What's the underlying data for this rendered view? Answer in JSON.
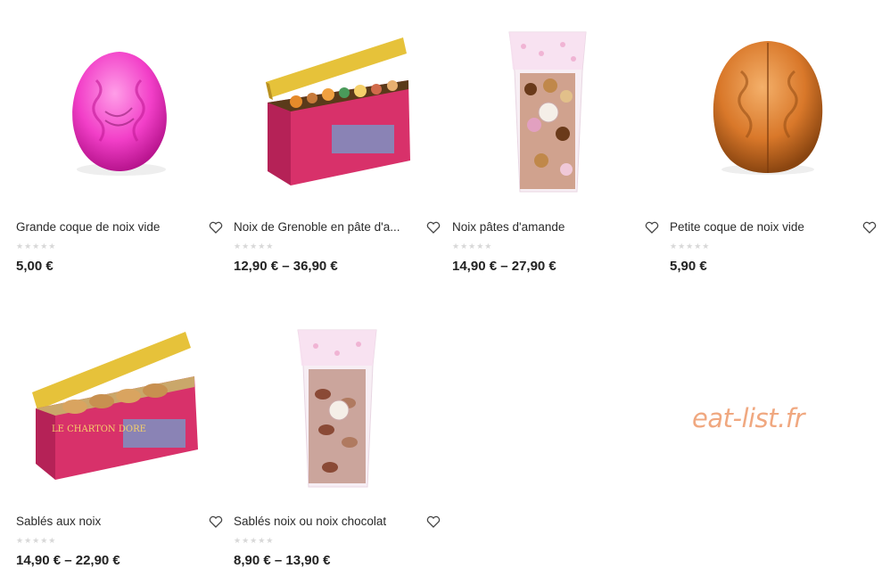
{
  "products": [
    {
      "title": "Grande coque de noix vide",
      "stars": "★★★★★",
      "price": "5,00 €",
      "icon": "pink-walnut-shell"
    },
    {
      "title": "Noix de Grenoble en pâte d'a...",
      "stars": "★★★★★",
      "price": "12,90 € – 36,90 €",
      "icon": "pink-tin-box-open"
    },
    {
      "title": "Noix pâtes d'amande",
      "stars": "★★★★★",
      "price": "14,90 € – 27,90 €",
      "icon": "candy-bag"
    },
    {
      "title": "Petite coque de noix vide",
      "stars": "★★★★★",
      "price": "5,90 €",
      "icon": "orange-walnut-shell"
    },
    {
      "title": "Sablés aux noix",
      "stars": "★★★★★",
      "price": "14,90 € – 22,90 €",
      "icon": "pink-tin-box-cookies"
    },
    {
      "title": "Sablés noix ou noix chocolat",
      "stars": "★★★★★",
      "price": "8,90 € – 13,90 €",
      "icon": "cookie-bag"
    }
  ],
  "watermark": "eat-list.fr",
  "colors": {
    "accent_pink": "#e83fbf",
    "orange_shell": "#d9782a",
    "tin_pink": "#d8316a",
    "lid_gold": "#e6c23a",
    "watermark": "#f0a880"
  }
}
